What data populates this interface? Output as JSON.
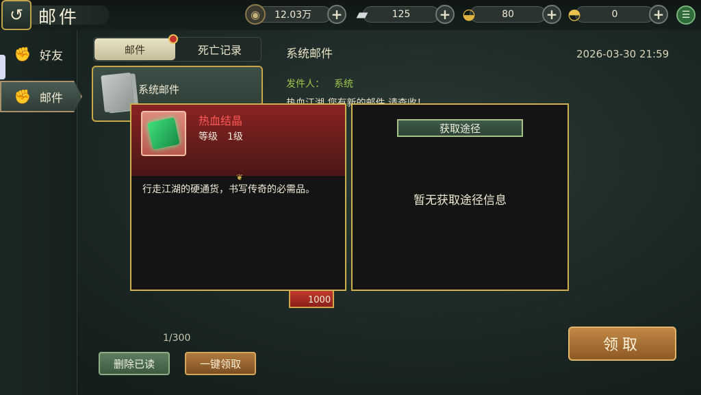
{
  "header": {
    "title": "邮件",
    "back_glyph": "↺"
  },
  "currencies": [
    {
      "name": "copper",
      "value": "12.03万",
      "icon": "coin-icon",
      "color": "#b8a070"
    },
    {
      "name": "silver",
      "value": "125",
      "icon": "silver-ingot-icon",
      "color": "#cfd3d6"
    },
    {
      "name": "gold",
      "value": "80",
      "icon": "gold-ingot-icon",
      "color": "#e0b341"
    },
    {
      "name": "yuanbao",
      "value": "0",
      "icon": "yuanbao-icon",
      "color": "#e8c24c"
    }
  ],
  "sidebar": {
    "items": [
      {
        "label": "好友",
        "icon": "fist-icon"
      },
      {
        "label": "邮件",
        "icon": "fist-icon",
        "active": true
      }
    ]
  },
  "mail_list": {
    "tabs": [
      {
        "label": "邮件",
        "active": true
      },
      {
        "label": "死亡记录",
        "active": false
      }
    ],
    "items": [
      {
        "title": "系统邮件"
      }
    ],
    "count": "1/300",
    "delete_read_label": "删除已读",
    "claim_all_label": "一键领取"
  },
  "detail": {
    "title": "系统邮件",
    "date": "2026-03-30 21:59",
    "sender_label": "发件人：",
    "sender": "系统",
    "body": "热血江湖,您有新的邮件,请查收！",
    "reward_qty": "1000",
    "claim_label": "领取"
  },
  "item_popup": {
    "name": "热血结晶",
    "level_label": "等级",
    "level_value": "1级",
    "description": "行走江湖的硬通货，书写传奇的必需品。",
    "name_color": "#ff5a55"
  },
  "source_popup": {
    "title": "获取途径",
    "empty_text": "暂无获取途径信息"
  }
}
